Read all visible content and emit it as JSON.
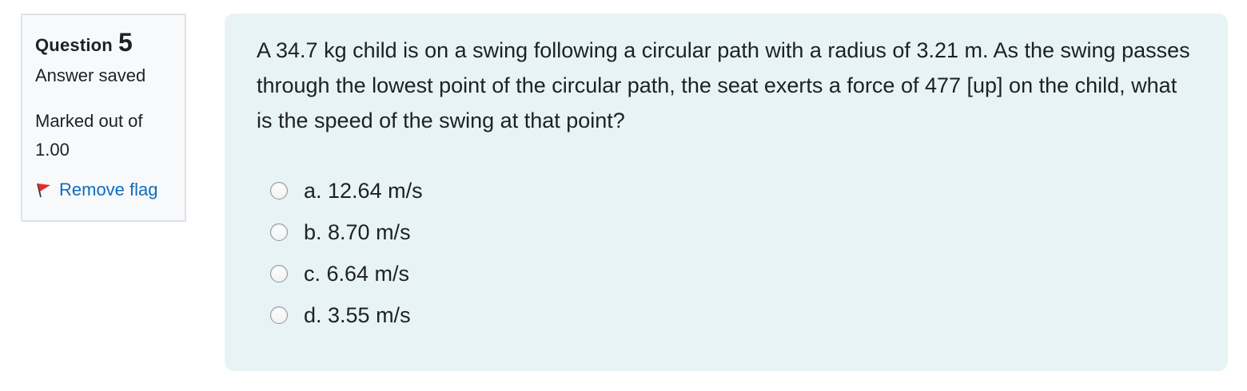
{
  "question_info": {
    "label": "Question",
    "number": "5",
    "state": "Answer saved",
    "grade": "Marked out of 1.00",
    "flag_label": "Remove flag",
    "flag_icon": "red-flag-icon",
    "flag_color": "#e12d2d",
    "link_color": "#0f6cbf"
  },
  "question": {
    "text": "A 34.7 kg child is on a swing following a circular path with a radius of 3.21 m.  As the swing passes through the lowest point of the circular path, the seat exerts a force of 477 [up] on the child, what is the speed of the swing at that point?",
    "options": [
      {
        "label": "a. 12.64 m/s"
      },
      {
        "label": "b. 8.70 m/s"
      },
      {
        "label": "c. 6.64 m/s"
      },
      {
        "label": "d. 3.55 m/s"
      }
    ]
  },
  "colors": {
    "content_background": "#e7f3f5",
    "info_background": "#f8f9fa",
    "info_border": "#dee2e6"
  }
}
